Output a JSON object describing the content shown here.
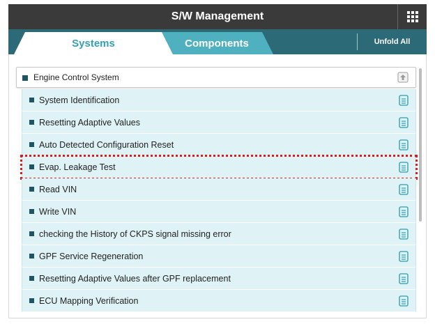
{
  "window": {
    "title": "S/W Management"
  },
  "tabs": [
    {
      "label": "Systems",
      "active": true
    },
    {
      "label": "Components",
      "active": false
    }
  ],
  "toolbar": {
    "unfold_all_label": "Unfold All"
  },
  "group": {
    "label": "Engine Control System"
  },
  "items": [
    {
      "label": "System Identification"
    },
    {
      "label": "Resetting Adaptive Values"
    },
    {
      "label": "Auto Detected Configuration Reset"
    },
    {
      "label": "Evap. Leakage Test"
    },
    {
      "label": "Read VIN"
    },
    {
      "label": "Write VIN"
    },
    {
      "label": "checking the History of  CKPS signal missing error"
    },
    {
      "label": "GPF Service Regeneration"
    },
    {
      "label": "Resetting Adaptive Values after GPF replacement"
    },
    {
      "label": "ECU Mapping Verification"
    }
  ],
  "icons": {
    "menu": "grid-menu-icon",
    "collapse": "collapse-up-icon",
    "item": "document-icon"
  },
  "colors": {
    "title_bar": "#3a3a3a",
    "tab_bar": "#2b6a76",
    "active_tab_text": "#35a0b4",
    "inactive_tab": "#4fb1c0",
    "item_bg": "#dff3f7",
    "highlight": "#e01b1b",
    "bullet": "#1f5563"
  }
}
